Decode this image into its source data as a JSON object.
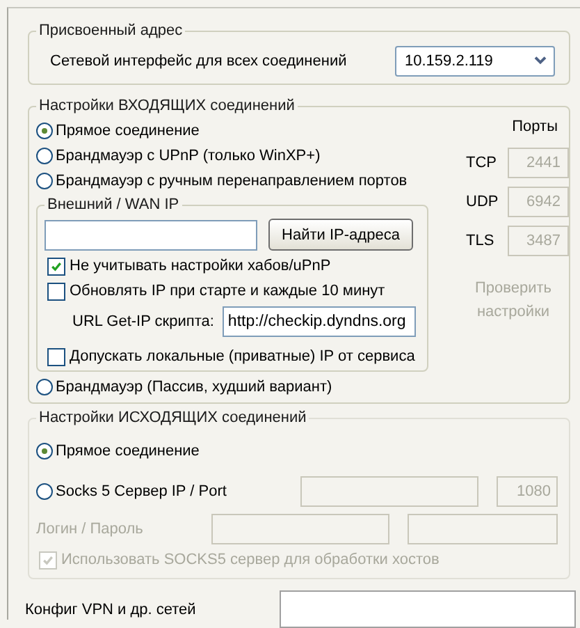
{
  "assigned_address": {
    "title": "Присвоенный адрес",
    "label": "Сетевой интерфейс для всех соединений",
    "interface": "10.159.2.119"
  },
  "incoming": {
    "title": "Настройки ВХОДЯЩИХ соединений",
    "modes": [
      {
        "label": "Прямое соединение",
        "selected": true
      },
      {
        "label": "Брандмауэр с UPnP (только WinXP+)",
        "selected": false
      },
      {
        "label": "Брандмауэр с ручным перенаправлением портов",
        "selected": false
      },
      {
        "label": "Брандмауэр (Пассив, худший вариант)",
        "selected": false
      }
    ],
    "wan_ip": {
      "title": "Внешний / WAN IP",
      "find_button": "Найти IP-адреса",
      "options": [
        {
          "label": "Не учитывать настройки хабов/uPnP",
          "checked": true
        },
        {
          "label": "Обновлять IP при старте и каждые 10 минут",
          "checked": false
        }
      ],
      "url_label": "URL Get-IP скрипта:",
      "url_value": "http://checkip.dyndns.org",
      "private_ip": {
        "label": "Допускать локальные (приватные) IP от сервиса",
        "checked": false
      }
    },
    "ports": {
      "title": "Порты",
      "disabled": true,
      "rows": [
        {
          "label": "TCP",
          "value": "2441"
        },
        {
          "label": "UDP",
          "value": "6942"
        },
        {
          "label": "TLS",
          "value": "3487"
        }
      ]
    },
    "check_button": {
      "label": "Проверить настройки",
      "disabled": true
    }
  },
  "outgoing": {
    "title": "Настройки ИСХОДЯЩИХ соединений",
    "modes": [
      {
        "label": "Прямое соединение",
        "selected": true
      },
      {
        "label": "Socks 5 Сервер IP / Port",
        "selected": false
      }
    ],
    "socks_port": "1080",
    "disabled": true,
    "login_label": "Логин / Пароль",
    "socks_hosts": {
      "label": "Использовать SOCKS5 сервер для обработки хостов",
      "checked": true
    }
  },
  "vpn": {
    "label": "Конфиг VPN и др. сетей"
  }
}
